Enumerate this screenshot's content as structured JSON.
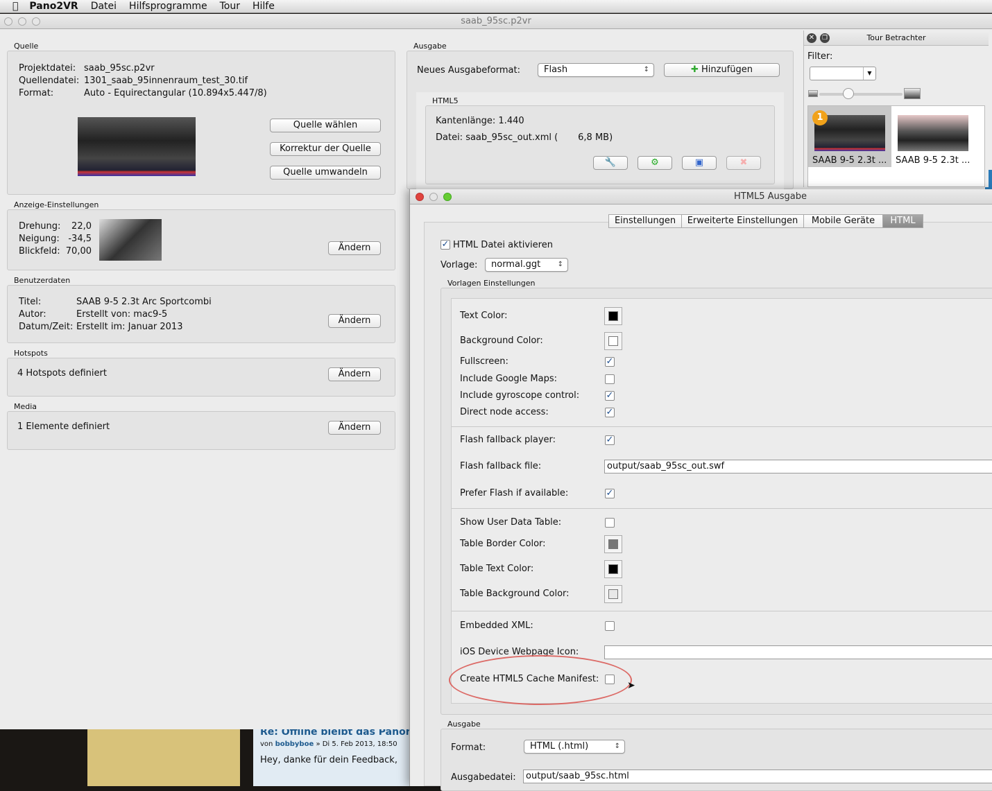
{
  "menubar": {
    "app": "Pano2VR",
    "items": [
      "Datei",
      "Hilfsprogramme",
      "Tour",
      "Hilfe"
    ]
  },
  "main_window": {
    "title": "saab_95sc.p2vr"
  },
  "quelle": {
    "label": "Quelle",
    "projektdatei_label": "Projektdatei:",
    "projektdatei": "saab_95sc.p2vr",
    "quelldatei_label": "Quellendatei:",
    "quelldatei": "1301_saab_95innenraum_test_30.tif",
    "format_label": "Format:",
    "format": "Auto - Equirectangular (10.894x5.447/8)",
    "buttons": [
      "Quelle wählen",
      "Korrektur der Quelle",
      "Quelle umwandeln"
    ]
  },
  "anzeige": {
    "label": "Anzeige-Einstellungen",
    "drehung_label": "Drehung:",
    "drehung": "22,0",
    "neigung_label": "Neigung:",
    "neigung": "-34,5",
    "blickfeld_label": "Blickfeld:",
    "blickfeld": "70,00",
    "button": "Ändern"
  },
  "benutzerdaten": {
    "label": "Benutzerdaten",
    "titel_label": "Titel:",
    "titel": "SAAB 9-5 2.3t Arc Sportcombi",
    "autor_label": "Autor:",
    "autor": "Erstellt von: mac9-5",
    "datum_label": "Datum/Zeit:",
    "datum": "Erstellt im: Januar 2013",
    "button": "Ändern"
  },
  "hotspots": {
    "label": "Hotspots",
    "text": "4 Hotspots definiert",
    "button": "Ändern"
  },
  "media": {
    "label": "Media",
    "text": "1 Elemente definiert",
    "button": "Ändern"
  },
  "ausgabe": {
    "label": "Ausgabe",
    "neues_label": "Neues Ausgabeformat:",
    "format": "Flash",
    "add_button": "Hinzufügen",
    "html5": {
      "label": "HTML5",
      "kantenlaenge": "Kantenlänge: 1.440",
      "datei": "Datei: saab_95sc_out.xml (       6,8 MB)"
    }
  },
  "tour": {
    "title": "Tour Betrachter",
    "filter_label": "Filter:",
    "filter_value": "",
    "items": [
      {
        "label": "SAAB 9-5 2.3t ...",
        "badge": "1",
        "selected": true
      },
      {
        "label": "SAAB 9-5 2.3t ...",
        "selected": false
      }
    ]
  },
  "dialog": {
    "title": "HTML5 Ausgabe",
    "tabs": [
      "Einstellungen",
      "Erweiterte Einstellungen",
      "Mobile Geräte",
      "HTML"
    ],
    "active_tab": "HTML",
    "enable_label": "HTML Datei aktivieren",
    "enable_checked": true,
    "vorlage_label": "Vorlage:",
    "vorlage": "normal.ggt",
    "vorlagen_label": "Vorlagen Einstellungen",
    "rows": [
      {
        "label": "Text Color:",
        "type": "color",
        "value": "#000000"
      },
      {
        "label": "Background Color:",
        "type": "color",
        "value": "#ffffff"
      },
      {
        "label": "Fullscreen:",
        "type": "check",
        "value": true
      },
      {
        "label": "Include Google Maps:",
        "type": "check",
        "value": false
      },
      {
        "label": "Include gyroscope control:",
        "type": "check",
        "value": true
      },
      {
        "label": "Direct node access:",
        "type": "check",
        "value": true
      },
      {
        "label": "Flash fallback player:",
        "type": "check",
        "value": true
      },
      {
        "label": "Flash fallback file:",
        "type": "text",
        "value": "output/saab_95sc_out.swf"
      },
      {
        "label": "Prefer Flash if available:",
        "type": "check",
        "value": true
      },
      {
        "label": "Show User Data Table:",
        "type": "check",
        "value": false
      },
      {
        "label": "Table Border Color:",
        "type": "color",
        "value": "#777777"
      },
      {
        "label": "Table Text Color:",
        "type": "color",
        "value": "#000000"
      },
      {
        "label": "Table Background Color:",
        "type": "color",
        "value": "#e8e8e8"
      },
      {
        "label": "Embedded XML:",
        "type": "check",
        "value": false
      },
      {
        "label": "iOS Device Webpage Icon:",
        "type": "text",
        "value": ""
      },
      {
        "label": "Create HTML5 Cache Manifest:",
        "type": "check",
        "value": false
      }
    ],
    "ausgabe_label": "Ausgabe",
    "format_label": "Format:",
    "format": "HTML (.html)",
    "ausgabedatei_label": "Ausgabedatei:",
    "ausgabedatei": "output/saab_95sc.html"
  },
  "background": {
    "forum_title": "Re: Offline bleibt das Panoram",
    "post_meta_prefix": "von",
    "post_author": "bobbyboe",
    "post_meta_suffix": "» Di 5. Feb 2013, 18:50",
    "post_text": "Hey, danke für dein Feedback,"
  },
  "colors": {
    "annotation_circle": "#d9534f",
    "accent": "#1f4f8f"
  }
}
